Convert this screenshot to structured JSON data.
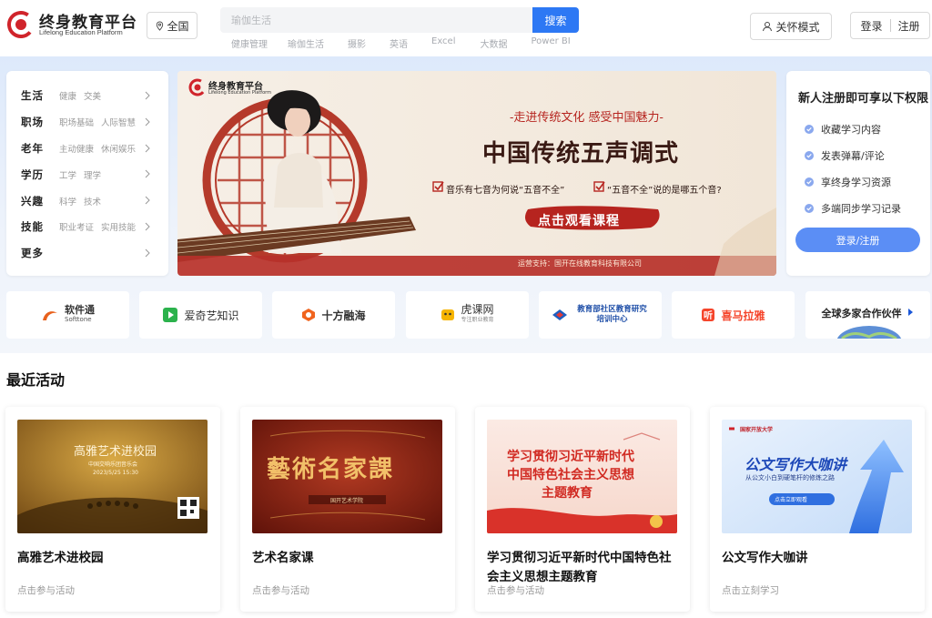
{
  "header": {
    "logo_cn": "终身教育平台",
    "logo_en": "Lifelong Education Platform",
    "region_label": "全国",
    "search_placeholder": "瑜伽生活",
    "search_button": "搜索",
    "hot_tags": [
      "健康管理",
      "瑜伽生活",
      "摄影",
      "英语",
      "Excel",
      "大数据",
      "Power BI"
    ],
    "care_mode": "关怀模式",
    "login": "登录",
    "register": "注册"
  },
  "categories": [
    {
      "name": "生活",
      "subs": [
        "健康",
        "交美"
      ]
    },
    {
      "name": "职场",
      "subs": [
        "职场基础",
        "人际智慧"
      ]
    },
    {
      "name": "老年",
      "subs": [
        "主动健康",
        "休闲娱乐"
      ]
    },
    {
      "name": "学历",
      "subs": [
        "工学",
        "理学"
      ]
    },
    {
      "name": "兴趣",
      "subs": [
        "科学",
        "技术"
      ]
    },
    {
      "name": "技能",
      "subs": [
        "职业考证",
        "实用技能"
      ]
    },
    {
      "name": "更多",
      "subs": []
    }
  ],
  "banner": {
    "logo_cn": "终身教育平台",
    "logo_en": "Lifelong Education Platform",
    "slogan": "-走进传统文化  感受中国魅力-",
    "title": "中国传统五声调式",
    "q1": "音乐有七音为何说“五音不全”",
    "q2": "“五音不全”说的是哪五个音?",
    "cta": "点击观看课程",
    "footer": "运营支持：国开在线教育科技有限公司"
  },
  "register": {
    "title": "新人注册即可享以下权限",
    "perks": [
      "收藏学习内容",
      "发表弹幕/评论",
      "享终身学习资源",
      "多端同步学习记录"
    ],
    "button": "登录/注册"
  },
  "partners": [
    {
      "name": "软件通",
      "sub": "Softtone",
      "color": "#e8611d"
    },
    {
      "name": "爱奇艺知识",
      "sub": "",
      "color": "#2bb24c"
    },
    {
      "name": "十方融海",
      "sub": "",
      "color": "#f0641e"
    },
    {
      "name": "虎课网",
      "sub": "专注职业教育",
      "color": "#f6b400"
    },
    {
      "name": "教育部社区教育研究培训中心",
      "sub": "",
      "color": "#1f5fbf"
    },
    {
      "name": "喜马拉雅",
      "sub": "",
      "color": "#f5452b"
    },
    {
      "name": "全球多家合作伙伴",
      "sub": "",
      "color": "#1a57d8"
    }
  ],
  "recent": {
    "title": "最近活动",
    "cards": [
      {
        "title": "高雅艺术进校园",
        "sub": "点击参与活动",
        "img_title": "高雅艺术进校园",
        "img_sub": "中国交响乐团音乐会",
        "img_date": "2023/5/25 15:30"
      },
      {
        "title": "艺术名家课",
        "sub": "点击参与活动",
        "img_title": "藝術名家課",
        "img_sub": "国开艺术学院"
      },
      {
        "title": "学习贯彻习近平新时代中国特色社会主义思想主题教育",
        "sub": "点击参与活动",
        "img_l1": "学习贯彻习近平新时代",
        "img_l2": "中国特色社会主义思想",
        "img_l3": "主题教育"
      },
      {
        "title": "公文写作大咖讲",
        "sub": "点击立刻学习",
        "img_title": "公文写作大咖讲",
        "img_sub": "从公文小白到硬笔杆的修炼之路",
        "img_btn": "点击立即观看",
        "img_org": "国家开放大学"
      }
    ]
  },
  "colors": {
    "brand_red": "#d0242b",
    "accent_blue": "#2d78f4",
    "register_btn": "#5b8ef5",
    "hero_bg": "#dde9fb"
  }
}
